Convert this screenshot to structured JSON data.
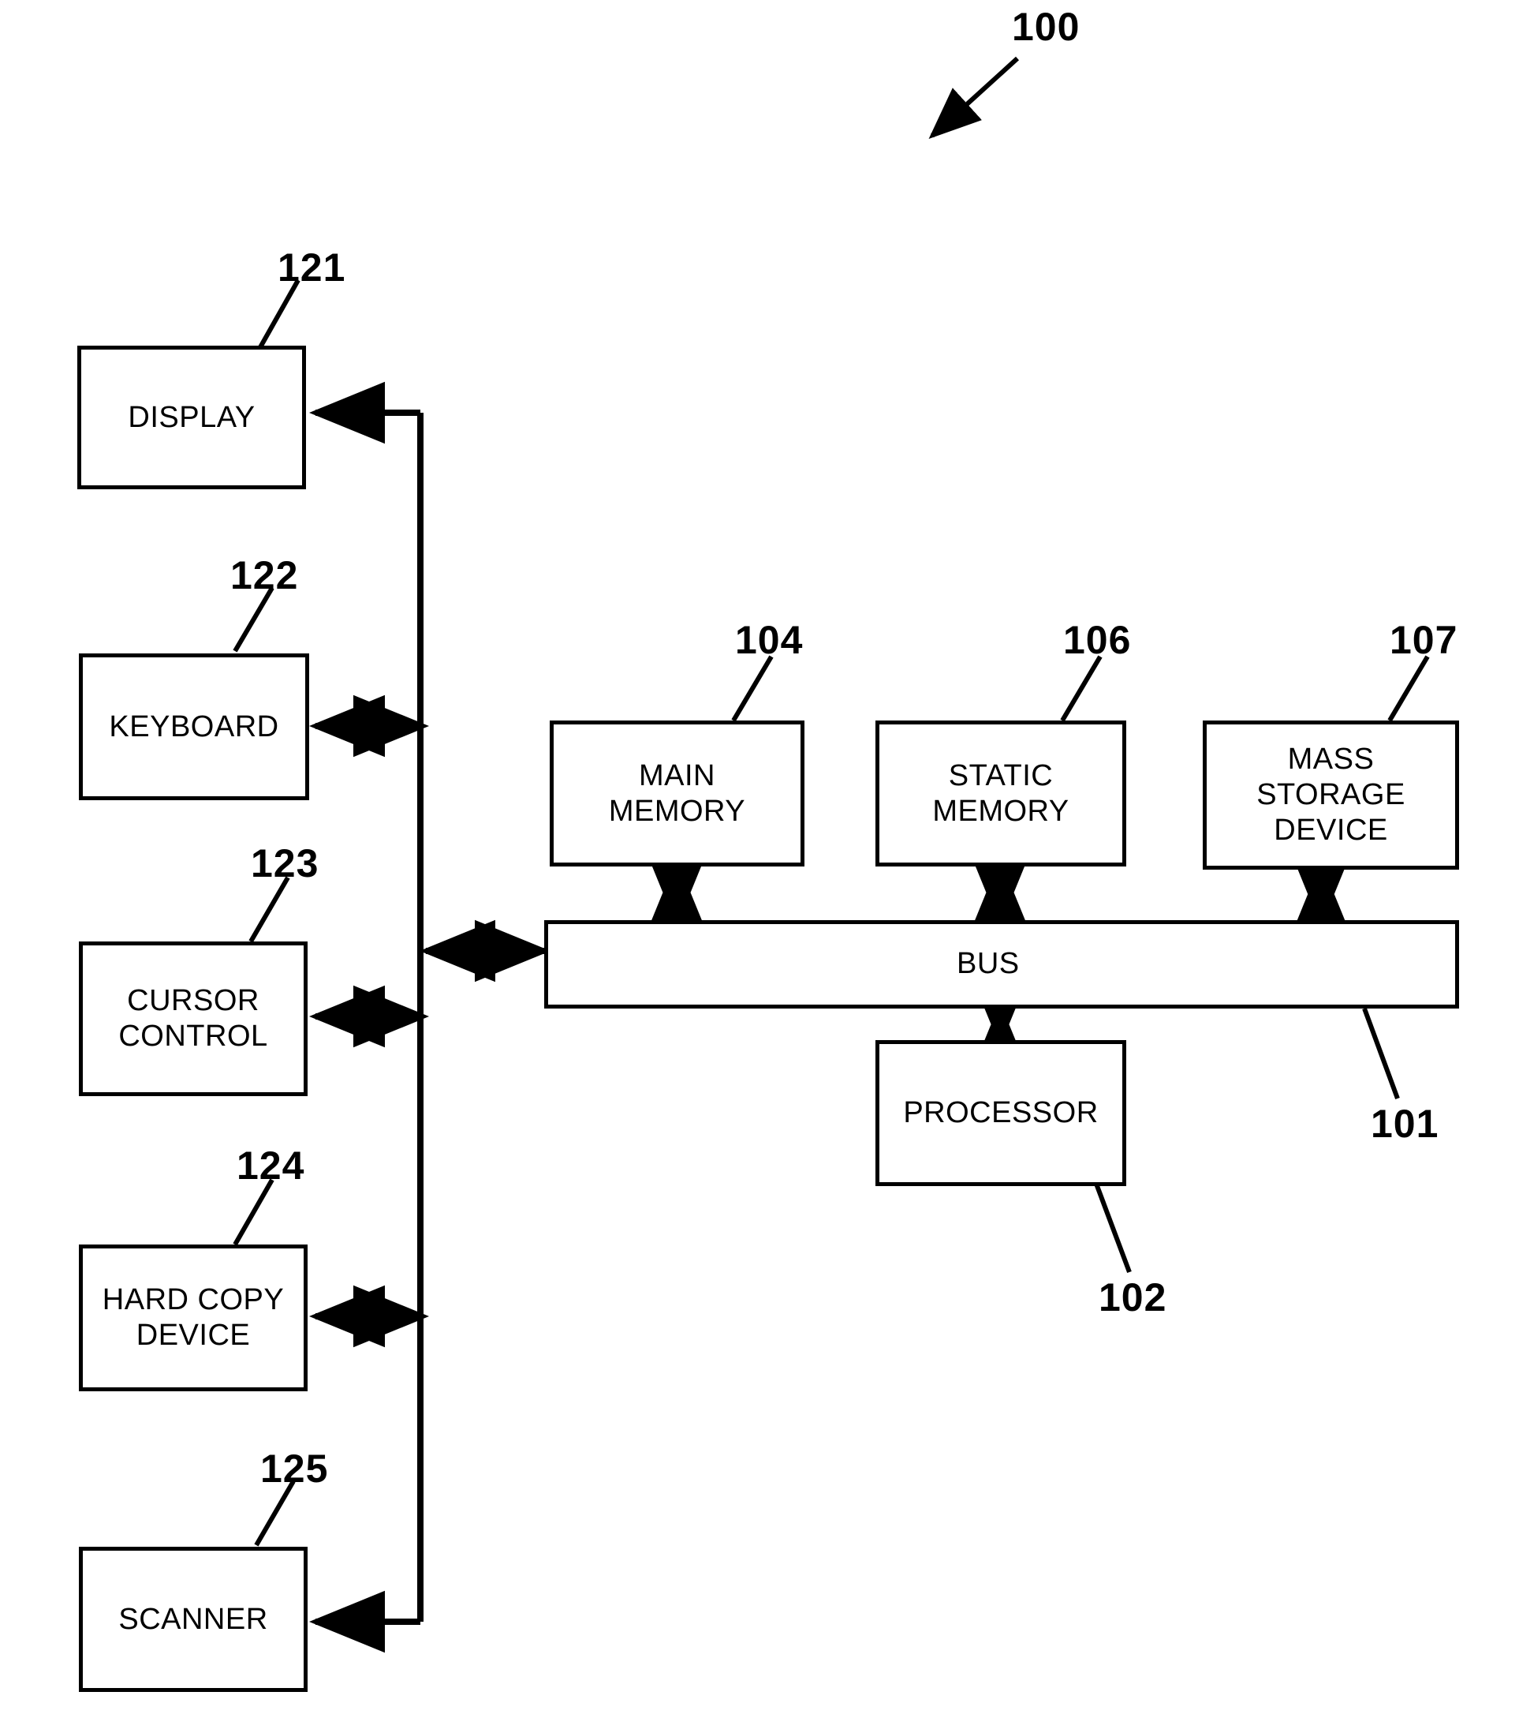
{
  "figure": {
    "title_ref": "100",
    "description": "Patent-style block diagram of a computer system architecture",
    "line_color": "#000000",
    "background_color": "#ffffff"
  },
  "boxes": {
    "display": {
      "label": "DISPLAY",
      "ref": "121"
    },
    "keyboard": {
      "label": "KEYBOARD",
      "ref": "122"
    },
    "cursor_control": {
      "label": "CURSOR\nCONTROL",
      "ref": "123"
    },
    "hard_copy_device": {
      "label": "HARD COPY\nDEVICE",
      "ref": "124"
    },
    "scanner": {
      "label": "SCANNER",
      "ref": "125"
    },
    "main_memory": {
      "label": "MAIN\nMEMORY",
      "ref": "104"
    },
    "static_memory": {
      "label": "STATIC\nMEMORY",
      "ref": "106"
    },
    "mass_storage_device": {
      "label": "MASS\nSTORAGE\nDEVICE",
      "ref": "107"
    },
    "bus": {
      "label": "BUS",
      "ref": "101"
    },
    "processor": {
      "label": "PROCESSOR",
      "ref": "102"
    }
  },
  "connections": [
    {
      "from": "bus-trunk",
      "to": "display",
      "type": "unidirectional"
    },
    {
      "from": "bus-trunk",
      "to": "keyboard",
      "type": "bidirectional"
    },
    {
      "from": "bus-trunk",
      "to": "cursor_control",
      "type": "bidirectional"
    },
    {
      "from": "bus-trunk",
      "to": "hard_copy_device",
      "type": "bidirectional"
    },
    {
      "from": "bus-trunk",
      "to": "scanner",
      "type": "unidirectional"
    },
    {
      "from": "bus-trunk",
      "to": "bus",
      "type": "bidirectional"
    },
    {
      "from": "main_memory",
      "to": "bus",
      "type": "bidirectional"
    },
    {
      "from": "static_memory",
      "to": "bus",
      "type": "bidirectional"
    },
    {
      "from": "mass_storage_device",
      "to": "bus",
      "type": "bidirectional"
    },
    {
      "from": "bus",
      "to": "processor",
      "type": "bidirectional"
    }
  ]
}
